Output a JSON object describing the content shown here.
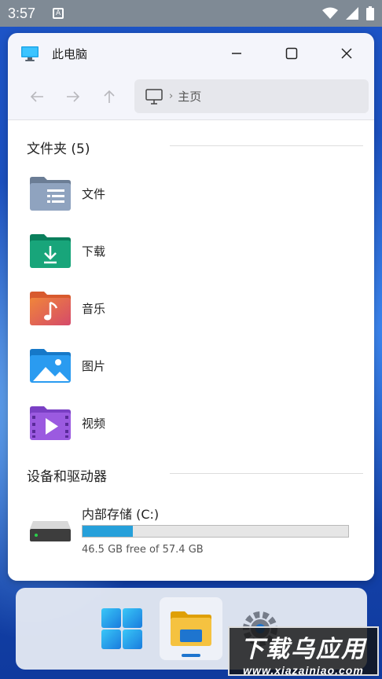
{
  "status_bar": {
    "time": "3:57"
  },
  "window": {
    "title": "此电脑",
    "breadcrumb": "主页"
  },
  "sections": {
    "folders_header": "文件夹 (5)",
    "drives_header": "设备和驱动器"
  },
  "folders": [
    {
      "label": "文件",
      "icon": "documents-folder-icon"
    },
    {
      "label": "下载",
      "icon": "downloads-folder-icon"
    },
    {
      "label": "音乐",
      "icon": "music-folder-icon"
    },
    {
      "label": "图片",
      "icon": "pictures-folder-icon"
    },
    {
      "label": "视频",
      "icon": "videos-folder-icon"
    }
  ],
  "drive": {
    "name": "内部存储 (C:)",
    "info": "46.5 GB free of 57.4 GB",
    "used_fraction": 0.19,
    "bar_color": "#26a0da"
  },
  "taskbar": {
    "items": [
      "start-icon",
      "file-explorer-icon",
      "settings-icon"
    ]
  },
  "watermark": {
    "main": "下载乌应用",
    "sub": "www.xiazainiao.com"
  }
}
